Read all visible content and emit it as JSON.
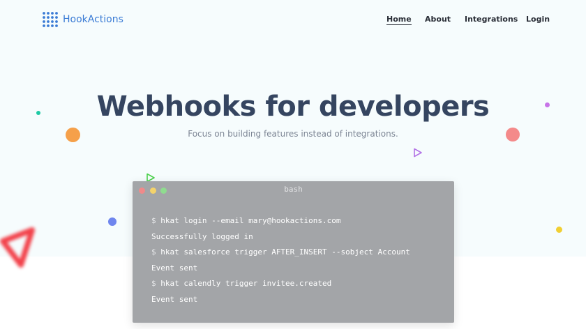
{
  "brand": {
    "name": "HookActions",
    "logo_icon": "dot-grid-logo-icon",
    "color": "#3a7bd5"
  },
  "nav": {
    "items": [
      {
        "label": "Home",
        "active": true
      },
      {
        "label": "About",
        "active": false
      },
      {
        "label": "Integrations",
        "active": false
      },
      {
        "label": "Login",
        "active": false
      }
    ]
  },
  "hero": {
    "title": "Webhooks for developers",
    "subtitle": "Focus on building features instead of integrations."
  },
  "terminal": {
    "title": "bash",
    "window_buttons": [
      "#f08a8a",
      "#f4d36b",
      "#8fdc8f"
    ],
    "lines": [
      {
        "prompt": "$",
        "text": "hkat login --email mary@hookactions.com"
      },
      {
        "prompt": "",
        "text": "Successfully logged in"
      },
      {
        "prompt": "$",
        "text": "hkat salesforce trigger AFTER_INSERT --sobject Account"
      },
      {
        "prompt": "",
        "text": "Event sent"
      },
      {
        "prompt": "$",
        "text": "hkat calendly trigger invitee.created"
      },
      {
        "prompt": "",
        "text": "Event sent"
      }
    ]
  },
  "colors": {
    "title": "#354560",
    "hero_background": "#f6fcfd",
    "terminal_background": "#a3a5a8"
  }
}
